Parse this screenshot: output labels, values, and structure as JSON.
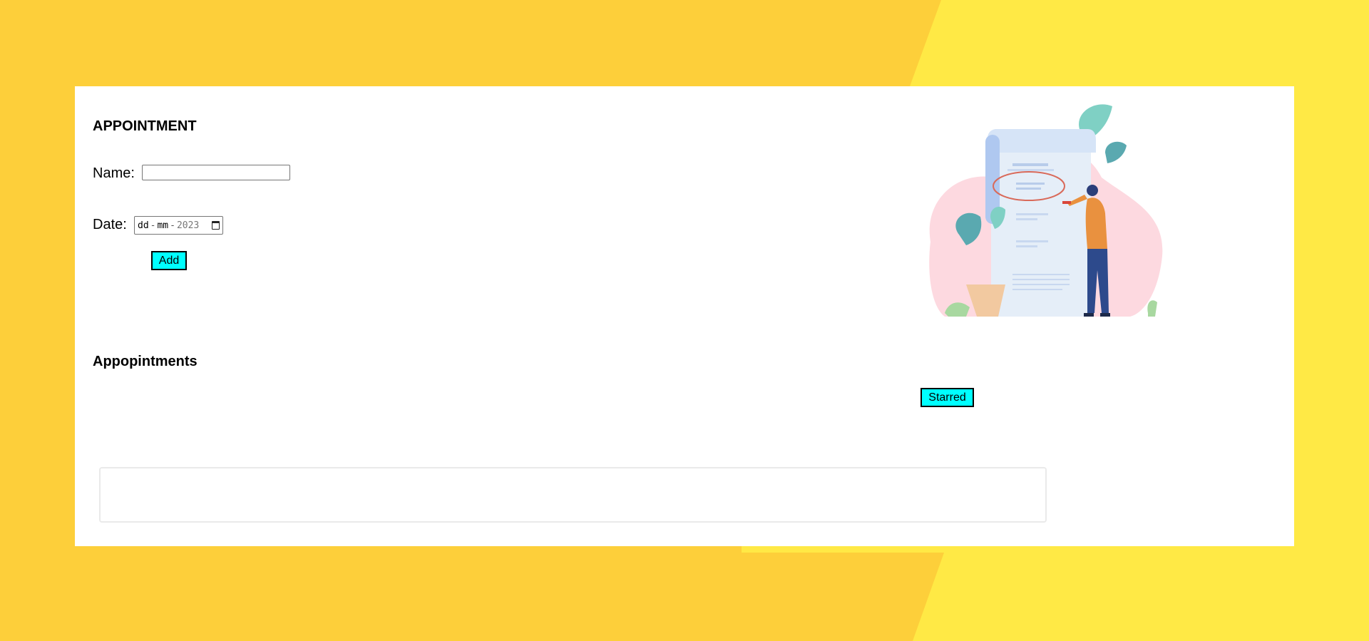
{
  "form": {
    "title": "APPOINTMENT",
    "name_label": "Name:",
    "name_value": "",
    "date_label": "Date:",
    "date_parts": {
      "day": "dd",
      "month": "mm",
      "year": "2023"
    },
    "add_label": "Add"
  },
  "list": {
    "heading": "Appopintments",
    "starred_label": "Starred",
    "items": []
  },
  "colors": {
    "background_light": "#FFE945",
    "background_dark": "#FDCF3A",
    "card": "#FFFFFF",
    "button": "#00FFFF"
  },
  "icons": {
    "date_picker": "calendar-icon",
    "illustration": "appointment-checklist-illustration"
  }
}
